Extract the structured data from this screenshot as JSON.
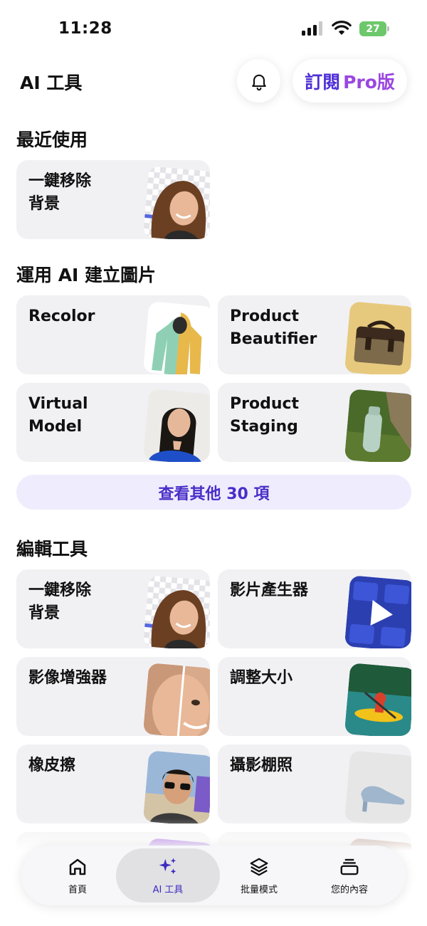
{
  "status_bar": {
    "time": "11:28",
    "battery": "27"
  },
  "header": {
    "title": "AI 工具",
    "pro_part1": "訂閱",
    "pro_part2": "Pro版"
  },
  "recent": {
    "title": "最近使用",
    "items": [
      {
        "label": "一鍵移除\n背景",
        "icon": "portrait-cutout-thumbnail"
      }
    ]
  },
  "create": {
    "title": "運用 AI 建立圖片",
    "items": [
      {
        "label": "Recolor",
        "icon": "hoodie-thumbnail"
      },
      {
        "label": "Product\nBeautifier",
        "icon": "bag-thumbnail"
      },
      {
        "label": "Virtual\nModel",
        "icon": "model-portrait-thumbnail"
      },
      {
        "label": "Product\nStaging",
        "icon": "bottle-thumbnail"
      }
    ],
    "more_label": "查看其他 30 項"
  },
  "edit": {
    "title": "編輯工具",
    "items": [
      {
        "label": "一鍵移除\n背景",
        "icon": "portrait-cutout-thumbnail"
      },
      {
        "label": "影片產生器",
        "icon": "video-play-thumbnail"
      },
      {
        "label": "影像增強器",
        "icon": "blur-face-thumbnail"
      },
      {
        "label": "調整大小",
        "icon": "kayak-thumbnail"
      },
      {
        "label": "橡皮擦",
        "icon": "selfie-thumbnail"
      },
      {
        "label": "攝影棚照",
        "icon": "shoe-thumbnail"
      }
    ]
  },
  "nav": {
    "items": [
      {
        "label": "首頁",
        "icon": "home-icon"
      },
      {
        "label": "AI 工具",
        "icon": "sparkles-icon"
      },
      {
        "label": "批量模式",
        "icon": "layers-icon"
      },
      {
        "label": "您的內容",
        "icon": "stack-icon"
      }
    ],
    "active_index": 1
  },
  "colors": {
    "accent": "#4a2ec8",
    "pro_gradient_end": "#9b46e0",
    "card_bg": "#f1f1f4",
    "battery": "#6cc86a"
  }
}
